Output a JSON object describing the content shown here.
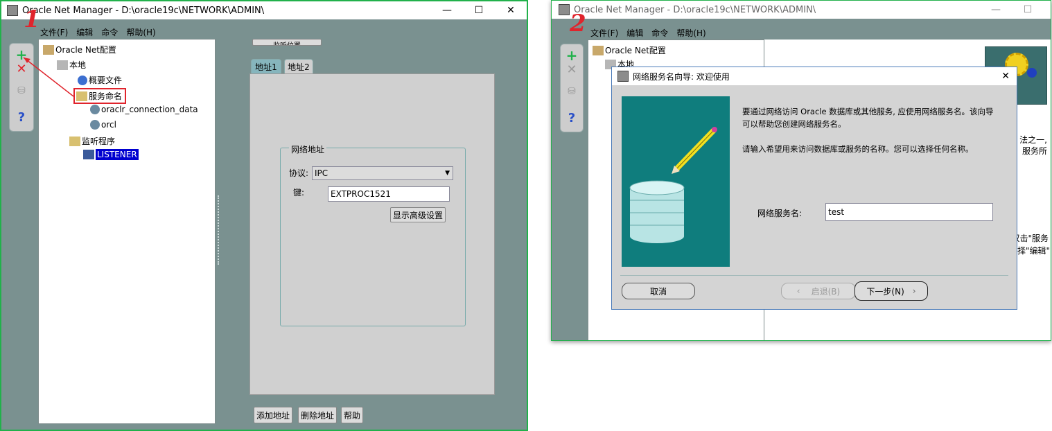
{
  "left_window": {
    "title": "Oracle Net Manager - D:\\oracle19c\\NETWORK\\ADMIN\\",
    "menu": [
      "文件(F)",
      "编辑",
      "命令",
      "帮助(H)"
    ],
    "tree": {
      "root": "Oracle Net配置",
      "local": "本地",
      "profile": "概要文件",
      "service_naming": "服务命名",
      "svc1": "oraclr_connection_data",
      "svc2": "orcl",
      "listeners": "监听程序",
      "listener": "LISTENER"
    },
    "top_button": "监听位置",
    "tabs": [
      "地址1",
      "地址2"
    ],
    "group_title": "网络地址",
    "protocol_label": "协议:",
    "protocol_value": "IPC",
    "key_label": "键:",
    "key_value": "EXTPROC1521",
    "advanced_button": "显示高级设置",
    "bottom_buttons": [
      "添加地址",
      "删除地址",
      "帮助"
    ]
  },
  "right_window": {
    "title": "Oracle Net Manager - D:\\oracle19c\\NETWORK\\ADMIN\\",
    "menu": [
      "文件(F)",
      "编辑",
      "命令",
      "帮助(H)"
    ],
    "tree": {
      "root": "Oracle Net配置",
      "local": "本地"
    },
    "side_texts": [
      "法之一,",
      "服务所",
      "双击\"服务",
      "选择\"编辑\""
    ],
    "dialog": {
      "title": "网络服务名向导: 欢迎使用",
      "intro_text_1": "要通过网络访问 Oracle 数据库或其他服务, 应使用网络服务名。该向导",
      "intro_text_2": "可以帮助您创建网络服务名。",
      "intro_text_3": "请输入希望用来访问数据库或服务的名称。您可以选择任何名称。",
      "service_name_label": "网络服务名:",
      "service_name_value": "test",
      "cancel_label": "取消",
      "back_label": "启退(B)",
      "next_label": "下一步(N)"
    }
  },
  "annotations": {
    "step1": "1",
    "step2": "2"
  },
  "colors": {
    "frame": "#7a9190",
    "accent_green": "#21b14b",
    "highlight_red": "#e0242c",
    "selection": "#0000d0",
    "wizard_teal": "#0f7d7d"
  }
}
